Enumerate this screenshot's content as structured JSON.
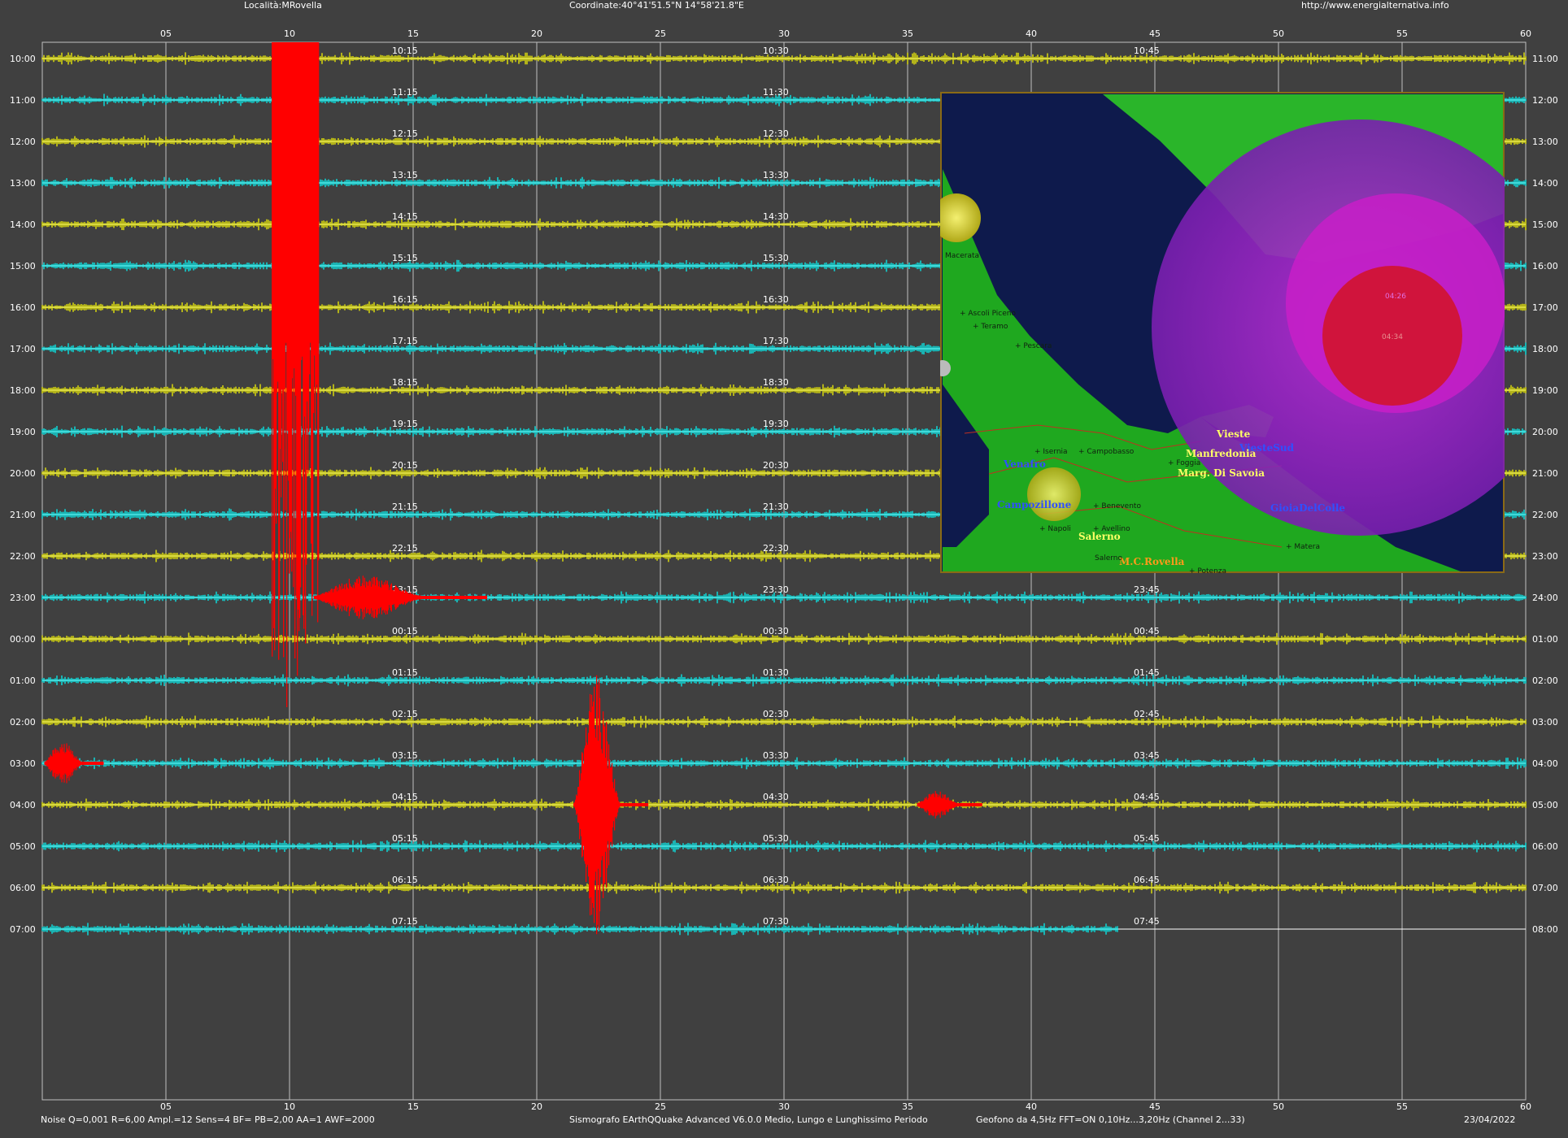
{
  "header": {
    "location": "Località:MRovella",
    "coordinates": "Coordinate:40°41'51.5\"N 14°58'21.8\"E",
    "url": "http://www.energialternativa.info"
  },
  "footer": {
    "settings": "Noise Q=0,001 R=6,00 Ampl.=12 Sens=4 BF= PB=2,00 AA=1 AWF=2000",
    "software": "Sismografo  EArthQQuake Advanced V6.0.0  Medio, Lungo e Lunghissimo Periodo",
    "sensor": "Geofono da 4,5Hz FFT=ON 0,10Hz...3,20Hz     (Channel 2...33)",
    "date": "23/04/2022"
  },
  "chart_data": {
    "type": "line",
    "x_axis": {
      "range": [
        0,
        60
      ],
      "unit": "minutes",
      "ticks": [
        "05",
        "10",
        "15",
        "20",
        "25",
        "30",
        "35",
        "40",
        "45",
        "50",
        "55",
        "60"
      ],
      "grid": true
    },
    "left_labels": [
      "10:00",
      "11:00",
      "12:00",
      "13:00",
      "14:00",
      "15:00",
      "16:00",
      "17:00",
      "18:00",
      "19:00",
      "20:00",
      "21:00",
      "22:00",
      "23:00",
      "00:00",
      "01:00",
      "02:00",
      "03:00",
      "04:00",
      "05:00",
      "06:00",
      "07:00"
    ],
    "right_labels": [
      "11:00",
      "12:00",
      "13:00",
      "14:00",
      "15:00",
      "16:00",
      "17:00",
      "18:00",
      "19:00",
      "20:00",
      "21:00",
      "22:00",
      "23:00",
      "24:00",
      "01:00",
      "02:00",
      "03:00",
      "04:00",
      "05:00",
      "06:00",
      "07:00",
      "08:00"
    ],
    "quarter_labels": [
      [
        "10:15",
        "10:30",
        "10:45"
      ],
      [
        "11:15",
        "11:30",
        ""
      ],
      [
        "12:15",
        "12:30",
        ""
      ],
      [
        "13:15",
        "13:30",
        ""
      ],
      [
        "14:15",
        "14:30",
        ""
      ],
      [
        "15:15",
        "15:30",
        ""
      ],
      [
        "16:15",
        "16:30",
        ""
      ],
      [
        "17:15",
        "17:30",
        ""
      ],
      [
        "18:15",
        "18:30",
        ""
      ],
      [
        "19:15",
        "19:30",
        ""
      ],
      [
        "20:15",
        "20:30",
        ""
      ],
      [
        "21:15",
        "21:30",
        ""
      ],
      [
        "22:15",
        "22:30",
        ""
      ],
      [
        "23:15",
        "23:30",
        "23:45"
      ],
      [
        "00:15",
        "00:30",
        "00:45"
      ],
      [
        "01:15",
        "01:30",
        "01:45"
      ],
      [
        "02:15",
        "02:30",
        "02:45"
      ],
      [
        "03:15",
        "03:30",
        "03:45"
      ],
      [
        "04:15",
        "04:30",
        "04:45"
      ],
      [
        "05:15",
        "05:30",
        "05:45"
      ],
      [
        "06:15",
        "06:30",
        "06:45"
      ],
      [
        "07:15",
        "07:30",
        "07:45"
      ]
    ],
    "trace_colors": [
      "#ffff00",
      "#00ffff"
    ],
    "event_color": "#ff0000",
    "events": [
      {
        "row": 0,
        "start_min": 9.3,
        "end_min": 11.2,
        "amplitude": 800,
        "label": "main quake"
      },
      {
        "row": 13,
        "start_min": 11.0,
        "end_min": 18.0,
        "amplitude": 30
      },
      {
        "row": 17,
        "start_min": 0.1,
        "end_min": 2.5,
        "amplitude": 30
      },
      {
        "row": 18,
        "start_min": 21.5,
        "end_min": 24.5,
        "amplitude": 190
      },
      {
        "row": 18,
        "start_min": 35.4,
        "end_min": 38.0,
        "amplitude": 18
      }
    ],
    "trace_end_min": 43.5
  },
  "map": {
    "cities": [
      {
        "name": "Vieste",
        "color": "#ffff66",
        "style": "bold"
      },
      {
        "name": "ViesteSud",
        "color": "#3050ff",
        "style": "bold"
      },
      {
        "name": "Manfredonia",
        "color": "#ffff66",
        "style": "bold"
      },
      {
        "name": "Marg. Di Savoia",
        "color": "#ffff66",
        "style": "bold"
      },
      {
        "name": "Venafro",
        "color": "#3050ff",
        "style": "bold"
      },
      {
        "name": "Campozillone",
        "color": "#3050ff",
        "style": "bold"
      },
      {
        "name": "Salerno",
        "color": "#ffff66",
        "style": "bold"
      },
      {
        "name": "M.C.Rovella",
        "color": "#ff9a1a",
        "style": "bold"
      },
      {
        "name": "GioiaDelColle",
        "color": "#3050ff",
        "style": "bold"
      }
    ],
    "towns": [
      "Macerata",
      "+ Ascoli Piceno",
      "+ Teramo",
      "+ Pescara",
      "+ Isernia",
      "+ Campobasso",
      "+ Foggia",
      "+ Benevento",
      "+ Avellino",
      "+ Napoli",
      "Salerno",
      "+ Potenza",
      "+ Matera"
    ],
    "event_times": [
      "04:34",
      "04:26"
    ]
  }
}
